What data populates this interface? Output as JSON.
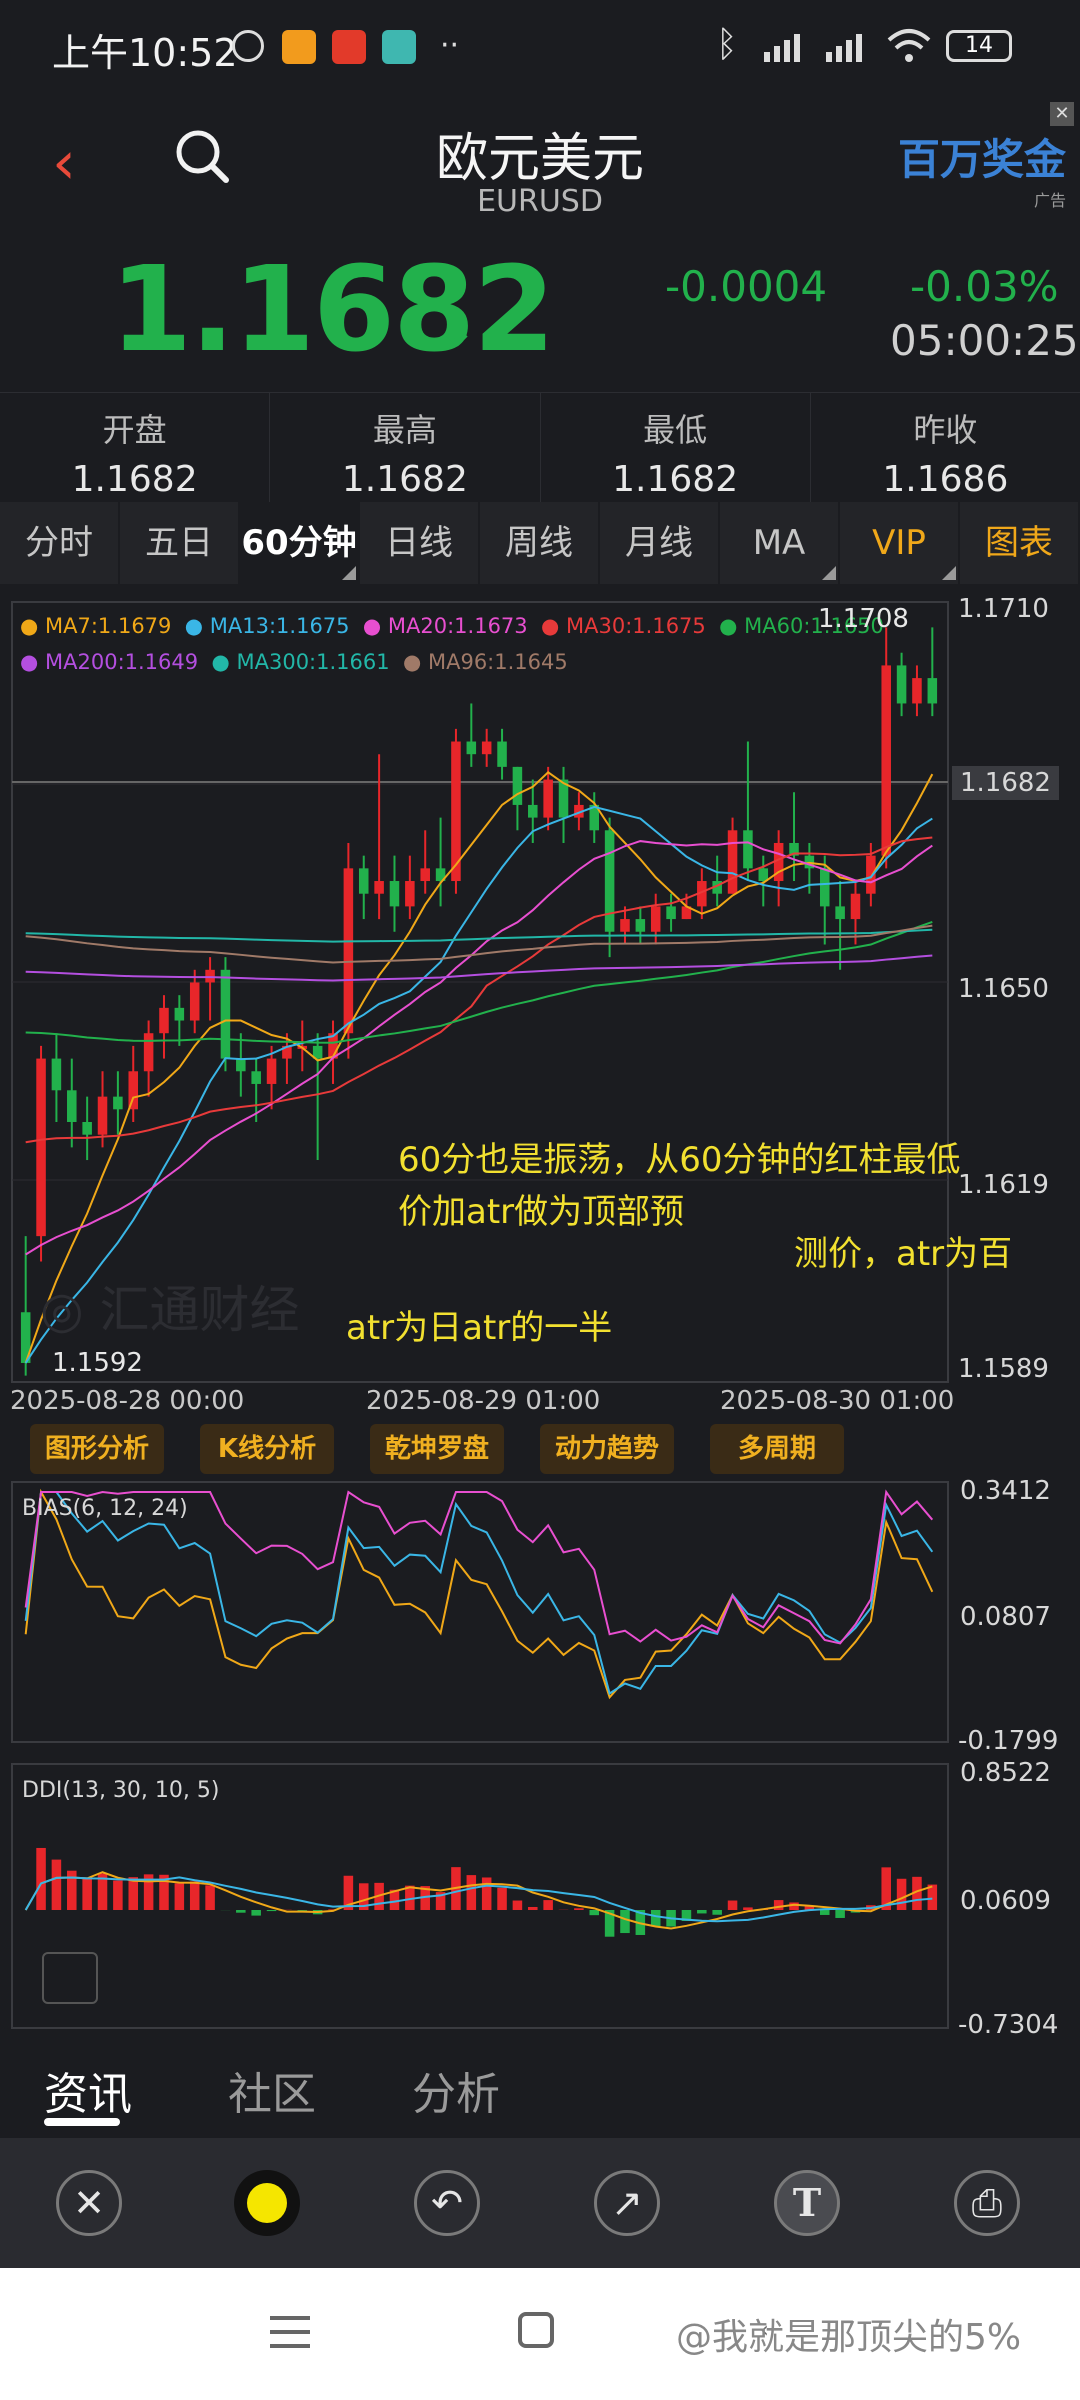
{
  "status": {
    "time": "上午10:52",
    "battery": "14"
  },
  "header": {
    "title": "欧元美元",
    "subtitle": "EURUSD",
    "ad_text": "百万奖金",
    "ad_label": "广告"
  },
  "quote": {
    "price": "1.1682",
    "arrow": "↓",
    "change": "-0.0004",
    "change_pct": "-0.03%",
    "time": "05:00:25"
  },
  "ohlc": [
    {
      "label": "开盘",
      "value": "1.1682"
    },
    {
      "label": "最高",
      "value": "1.1682"
    },
    {
      "label": "最低",
      "value": "1.1682"
    },
    {
      "label": "昨收",
      "value": "1.1686"
    }
  ],
  "tabs": [
    "分时",
    "五日",
    "60分钟",
    "日线",
    "周线",
    "月线",
    "MA",
    "VIP",
    "图表"
  ],
  "chart_data": [
    {
      "type": "candlestick",
      "ma_legend_row1": [
        "MA7:1.1679",
        "MA13:1.1675",
        "MA20:1.1673",
        "MA30:1.1675",
        "MA60:1.1650"
      ],
      "ma_legend_row2": [
        "MA200:1.1649",
        "MA300:1.1661",
        "MA96:1.1645"
      ],
      "ma_colors": [
        "#f0a818",
        "#3ab6e6",
        "#e84fd0",
        "#e83a3a",
        "#22b14c",
        "#b44fe0",
        "#22b7a8",
        "#a07a68"
      ],
      "y_ticks": [
        "1.1710",
        "1.1682",
        "1.1650",
        "1.1619",
        "1.1589"
      ],
      "current_price_label": "1.1682",
      "max_label": "1.1708",
      "min_label": "1.1592",
      "x_labels": [
        "2025-08-28 00:00",
        "2025-08-29 01:00",
        "2025-08-30 01:00"
      ],
      "ylim": [
        1.1589,
        1.1712
      ],
      "candles": [
        [
          1.16,
          1.1592,
          1.1612,
          1.159
        ],
        [
          1.1612,
          1.164,
          1.1642,
          1.1608
        ],
        [
          1.164,
          1.1635,
          1.1644,
          1.163
        ],
        [
          1.1635,
          1.163,
          1.164,
          1.1626
        ],
        [
          1.163,
          1.1628,
          1.1634,
          1.1624
        ],
        [
          1.1628,
          1.1634,
          1.1638,
          1.1626
        ],
        [
          1.1634,
          1.1632,
          1.1638,
          1.1628
        ],
        [
          1.1632,
          1.1638,
          1.1642,
          1.163
        ],
        [
          1.1638,
          1.1644,
          1.1646,
          1.1634
        ],
        [
          1.1644,
          1.1648,
          1.165,
          1.164
        ],
        [
          1.1648,
          1.1646,
          1.165,
          1.1642
        ],
        [
          1.1646,
          1.1652,
          1.1654,
          1.1644
        ],
        [
          1.1652,
          1.1654,
          1.1656,
          1.1646
        ],
        [
          1.1654,
          1.164,
          1.1656,
          1.1638
        ],
        [
          1.164,
          1.1638,
          1.1644,
          1.1634
        ],
        [
          1.1638,
          1.1636,
          1.164,
          1.163
        ],
        [
          1.1636,
          1.164,
          1.1642,
          1.1632
        ],
        [
          1.164,
          1.1642,
          1.1644,
          1.1636
        ],
        [
          1.1642,
          1.1642,
          1.1646,
          1.1638
        ],
        [
          1.1642,
          1.164,
          1.1644,
          1.1624
        ],
        [
          1.164,
          1.1644,
          1.1646,
          1.1636
        ],
        [
          1.1644,
          1.167,
          1.1674,
          1.164
        ],
        [
          1.167,
          1.1666,
          1.1672,
          1.1662
        ],
        [
          1.1666,
          1.1668,
          1.1688,
          1.1662
        ],
        [
          1.1668,
          1.1664,
          1.1672,
          1.166
        ],
        [
          1.1664,
          1.1668,
          1.1672,
          1.1662
        ],
        [
          1.1668,
          1.167,
          1.1676,
          1.1666
        ],
        [
          1.167,
          1.1668,
          1.1678,
          1.1664
        ],
        [
          1.1668,
          1.169,
          1.1692,
          1.1666
        ],
        [
          1.169,
          1.1688,
          1.1696,
          1.1686
        ],
        [
          1.1688,
          1.169,
          1.1692,
          1.1686
        ],
        [
          1.169,
          1.1686,
          1.1692,
          1.1684
        ],
        [
          1.1686,
          1.168,
          1.1686,
          1.1676
        ],
        [
          1.168,
          1.1678,
          1.1684,
          1.1674
        ],
        [
          1.1678,
          1.1684,
          1.1686,
          1.1676
        ],
        [
          1.1684,
          1.1678,
          1.1686,
          1.1674
        ],
        [
          1.1678,
          1.168,
          1.1682,
          1.1676
        ],
        [
          1.168,
          1.1676,
          1.1682,
          1.1674
        ],
        [
          1.1676,
          1.166,
          1.1678,
          1.1656
        ],
        [
          1.166,
          1.1662,
          1.1664,
          1.1658
        ],
        [
          1.1662,
          1.166,
          1.1664,
          1.1658
        ],
        [
          1.166,
          1.1664,
          1.1666,
          1.1658
        ],
        [
          1.1664,
          1.1662,
          1.1666,
          1.166
        ],
        [
          1.1662,
          1.1664,
          1.1666,
          1.1662
        ],
        [
          1.1664,
          1.1668,
          1.167,
          1.1662
        ],
        [
          1.1668,
          1.1666,
          1.1672,
          1.1664
        ],
        [
          1.1666,
          1.1676,
          1.1678,
          1.1666
        ],
        [
          1.1676,
          1.167,
          1.169,
          1.1668
        ],
        [
          1.167,
          1.1668,
          1.1672,
          1.1664
        ],
        [
          1.1668,
          1.1674,
          1.1676,
          1.1664
        ],
        [
          1.1674,
          1.1672,
          1.1682,
          1.1668
        ],
        [
          1.1672,
          1.167,
          1.1674,
          1.1666
        ],
        [
          1.167,
          1.1664,
          1.1672,
          1.1658
        ],
        [
          1.1664,
          1.1662,
          1.1668,
          1.1654
        ],
        [
          1.1662,
          1.1666,
          1.1668,
          1.1658
        ],
        [
          1.1666,
          1.1672,
          1.1674,
          1.1664
        ],
        [
          1.1672,
          1.1702,
          1.1708,
          1.167
        ],
        [
          1.1702,
          1.1696,
          1.1704,
          1.1694
        ],
        [
          1.1696,
          1.17,
          1.1702,
          1.1694
        ],
        [
          1.17,
          1.1696,
          1.1708,
          1.1694
        ]
      ]
    },
    {
      "type": "line",
      "label": "BIAS(6, 12, 24)",
      "y_ticks": [
        "0.3412",
        "0.0807",
        "-0.1799"
      ]
    },
    {
      "type": "bar",
      "label": "DDI(13, 30, 10, 5)",
      "y_ticks": [
        "0.8522",
        "0.0609",
        "-0.7304"
      ]
    }
  ],
  "tools": [
    "图形分析",
    "K线分析",
    "乾坤罗盘",
    "动力趋势",
    "多周期"
  ],
  "annotations": [
    "60分也是振荡，从60分钟的红柱最低",
    "价加atr做为顶部预",
    "测价，atr为百",
    "atr为日atr的一半"
  ],
  "watermark": "汇通财经",
  "bottom_tabs": [
    "资讯",
    "社区",
    "分析"
  ],
  "draw_tools": [
    "close-icon",
    "color-dot",
    "undo-icon",
    "arrow-icon",
    "text-icon",
    "save-icon"
  ],
  "draw_text_glyph": "T",
  "footer_user": "@我就是那顶尖的5%"
}
